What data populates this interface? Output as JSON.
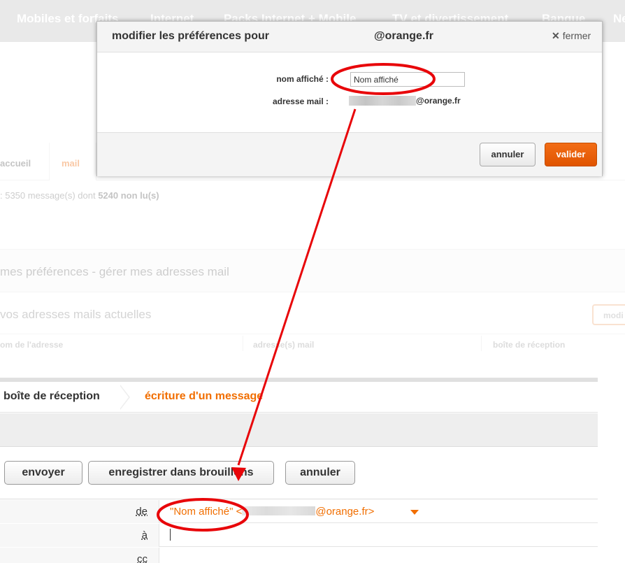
{
  "nav": {
    "items": [
      "Mobiles et forfaits",
      "Internet",
      "Packs Internet + Mobile",
      "TV et divertissement",
      "Banque",
      "Ne"
    ]
  },
  "background": {
    "tab_accueil": "accueil",
    "tab_mail": "mail",
    "message_count_prefix": ": 5350 message(s) dont",
    "message_count_unread": "5240 non lu(s)",
    "prefs_title": "mes préférences - gérer mes adresses mail",
    "addresses_title": "vos adresses mails actuelles",
    "modify_button": "modi",
    "columns": [
      "om de l'adresse",
      "adresse(s) mail",
      "boîte de réception"
    ]
  },
  "modal": {
    "title": "modifier les préférences pour",
    "domain": "@orange.fr",
    "close_label": "fermer",
    "display_name_label": "nom affiché :",
    "display_name_value": "Nom affiché",
    "email_label": "adresse mail :",
    "email_domain": "@orange.fr",
    "cancel_label": "annuler",
    "submit_label": "valider"
  },
  "composer": {
    "crumb_inbox": "boîte de réception",
    "crumb_write": "écriture d'un message",
    "send_label": "envoyer",
    "save_draft_label": "enregistrer dans brouillons",
    "cancel_label": "annuler",
    "from_label": "de",
    "from_name": "\"Nom affiché\" <",
    "from_domain": "@orange.fr>",
    "to_label": "à",
    "cc_label": "cc"
  },
  "colors": {
    "accent": "#f16e00",
    "annotation": "#e8060a"
  }
}
